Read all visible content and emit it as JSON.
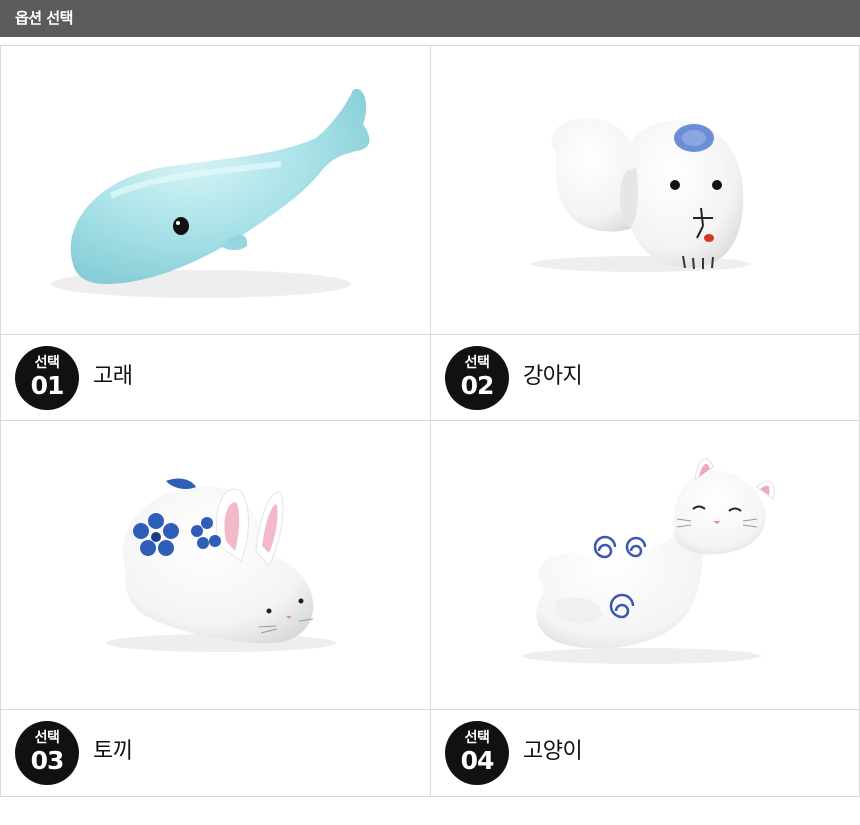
{
  "header": {
    "title": "옵션 선택"
  },
  "options": [
    {
      "badge_word": "선택",
      "number": "01",
      "name": "고래",
      "image": "whale-figurine"
    },
    {
      "badge_word": "선택",
      "number": "02",
      "name": "강아지",
      "image": "dog-figurine"
    },
    {
      "badge_word": "선택",
      "number": "03",
      "name": "토끼",
      "image": "rabbit-figurine"
    },
    {
      "badge_word": "선택",
      "number": "04",
      "name": "고양이",
      "image": "cat-figurine"
    }
  ],
  "colors": {
    "header_bg": "#5b5b5b",
    "badge_bg": "#111111",
    "border": "#d9d9d9",
    "whale": "#a9e2e8",
    "pattern_blue": "#4b6fc4"
  }
}
